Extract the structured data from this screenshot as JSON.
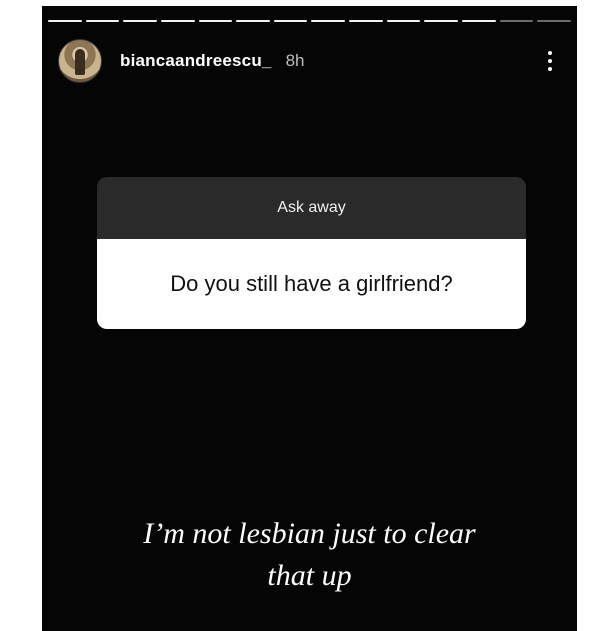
{
  "story": {
    "progress_segments": 14,
    "progress_completed": 12,
    "header": {
      "username": "biancaandreescu_",
      "time": "8h",
      "avatar_icon": "profile-photo",
      "more_icon": "more-vertical-icon"
    },
    "question_sticker": {
      "prompt": "Ask away",
      "question": "Do you still have a girlfriend?"
    },
    "caption": {
      "line1": "I’m not lesbian just to clear",
      "line2": "that up"
    }
  }
}
